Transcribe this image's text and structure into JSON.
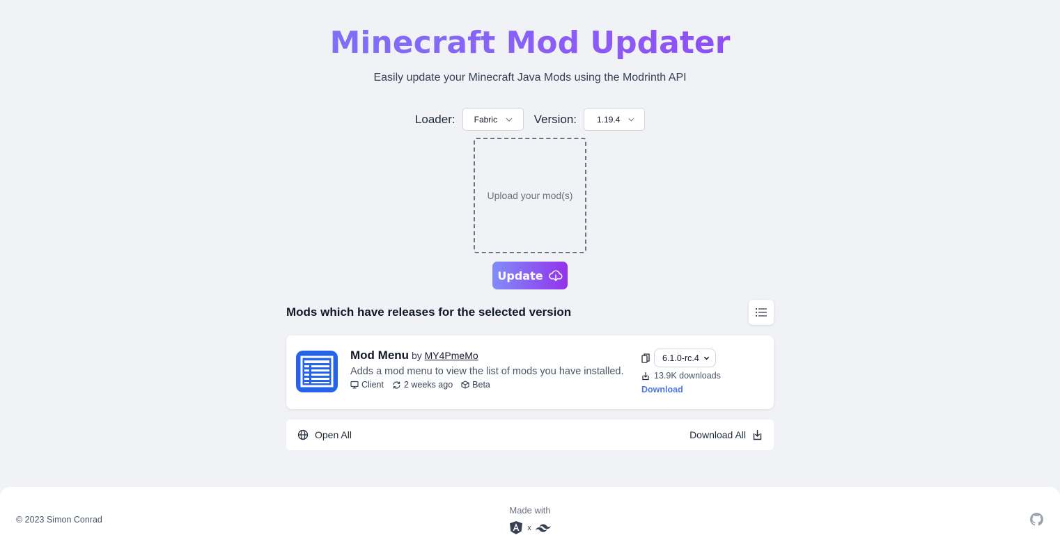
{
  "header": {
    "title": "Minecraft Mod Updater",
    "subtitle": "Easily update your Minecraft Java Mods using the Modrinth API"
  },
  "selectors": {
    "loader_label": "Loader:",
    "loader_value": "Fabric",
    "version_label": "Version:",
    "version_value": "1.19.4"
  },
  "upload": {
    "prompt": "Upload your mod(s)"
  },
  "update_button": {
    "label": "Update",
    "icon": "cloud-download-icon"
  },
  "results": {
    "section_title": "Mods which have releases for the selected version",
    "mods": [
      {
        "name": "Mod Menu",
        "by": "by",
        "author": "MY4PmeMo",
        "description": "Adds a mod menu to view the list of mods you have installed.",
        "environment": "Client",
        "updated": "2 weeks ago",
        "release_type": "Beta",
        "version": "6.1.0-rc.4",
        "downloads": "13.9K downloads",
        "download_label": "Download",
        "icon_color": "#2563eb"
      }
    ]
  },
  "actions": {
    "open_all": "Open All",
    "download_all": "Download All"
  },
  "footer": {
    "copyright": "© 2023 Simon Conrad",
    "made_with": "Made with",
    "separator": "x"
  },
  "colors": {
    "accent_start": "#818cf8",
    "accent_end": "#9333ea",
    "link": "#4c79e0",
    "background": "#f0f2f6"
  }
}
